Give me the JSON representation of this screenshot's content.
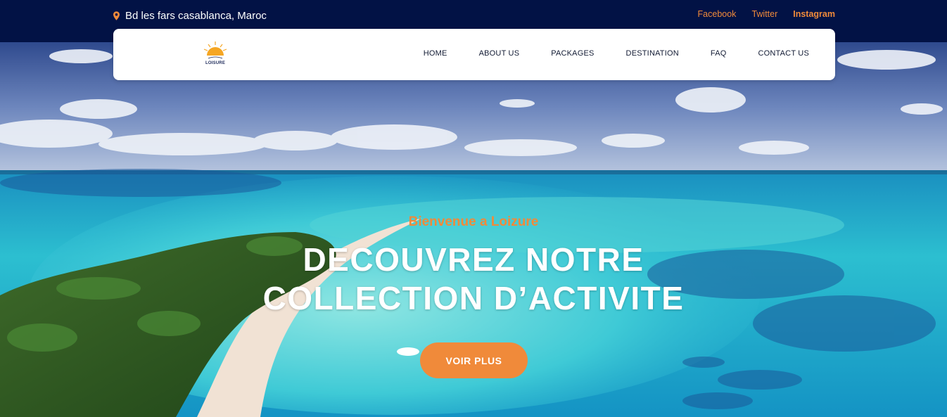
{
  "topbar": {
    "address": "Bd les fars casablanca, Maroc",
    "social": {
      "facebook": "Facebook",
      "twitter": "Twitter",
      "instagram": "Instagram"
    },
    "accent_color": "#f08a3a",
    "background_color": "#021245"
  },
  "brand": {
    "logo_text": "LOISURE"
  },
  "nav": {
    "items": [
      {
        "label": "HOME"
      },
      {
        "label": "ABOUT US"
      },
      {
        "label": "PACKAGES"
      },
      {
        "label": "DESTINATION"
      },
      {
        "label": "FAQ"
      },
      {
        "label": "CONTACT US"
      }
    ]
  },
  "hero": {
    "welcome": "Bienvenue a Loizure",
    "headline_line1": "DECOUVREZ NOTRE",
    "headline_line2": "COLLECTION D’ACTIVITE",
    "cta_label": "VOIR PLUS",
    "cta_color": "#f08a3a"
  },
  "icons": {
    "address": "map-pin-icon"
  }
}
